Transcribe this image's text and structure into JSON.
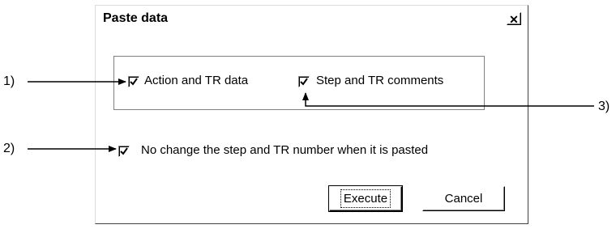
{
  "dialog": {
    "title": "Paste data",
    "close_glyph": "✕",
    "checkboxes": [
      {
        "label": "Action and TR data",
        "checked": true
      },
      {
        "label": "Step and TR comments",
        "checked": true
      },
      {
        "label": "No change the step and TR number when it is pasted",
        "checked": true
      }
    ],
    "execute_label": "Execute",
    "cancel_label": "Cancel"
  },
  "callouts": [
    "1)",
    "2)",
    "3)"
  ]
}
